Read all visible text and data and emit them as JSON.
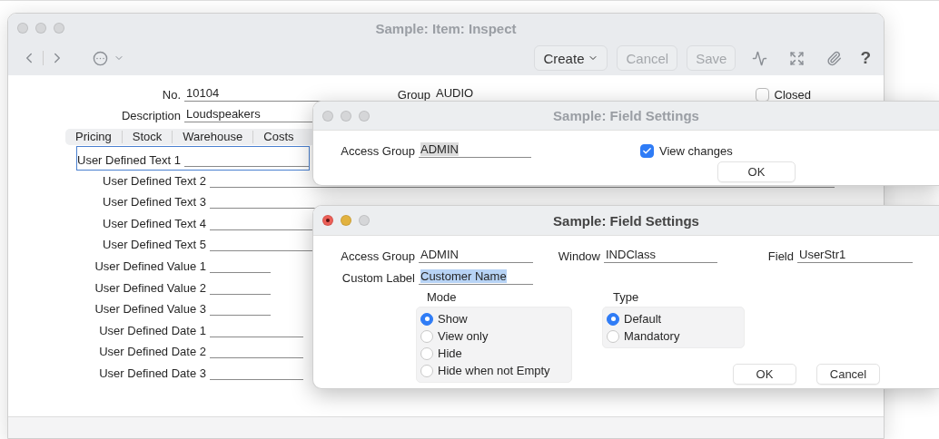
{
  "main_window": {
    "title": "Sample: Item: Inspect",
    "toolbar": {
      "buttons": [
        {
          "label": "Create",
          "kind": "menu",
          "disabled": false
        },
        {
          "label": "Cancel",
          "kind": "plain",
          "disabled": true
        },
        {
          "label": "Save",
          "kind": "plain",
          "disabled": true
        }
      ],
      "help": "?"
    },
    "header_fields": [
      {
        "label": "No.",
        "value": "10104"
      },
      {
        "label": "Description",
        "value": "Loudspeakers"
      },
      {
        "label": "Group",
        "value": "AUDIO"
      }
    ],
    "closed": {
      "label": "Closed",
      "checked": false
    },
    "tabs": [
      {
        "label": "Pricing",
        "selected": false
      },
      {
        "label": "Stock",
        "selected": false
      },
      {
        "label": "Warehouse",
        "selected": false
      },
      {
        "label": "Costs",
        "selected": false
      }
    ],
    "user_fields": [
      {
        "label": "User Defined Text 1",
        "kind": "text",
        "focused": true
      },
      {
        "label": "User Defined Text 2",
        "kind": "text",
        "focused": false
      },
      {
        "label": "User Defined Text 3",
        "kind": "text",
        "focused": false
      },
      {
        "label": "User Defined Text 4",
        "kind": "text",
        "focused": false
      },
      {
        "label": "User Defined Text 5",
        "kind": "text",
        "focused": false
      },
      {
        "label": "User Defined Value 1",
        "kind": "value",
        "focused": false
      },
      {
        "label": "User Defined Value 2",
        "kind": "value",
        "focused": false
      },
      {
        "label": "User Defined Value 3",
        "kind": "value",
        "focused": false
      },
      {
        "label": "User Defined Date 1",
        "kind": "date",
        "focused": false
      },
      {
        "label": "User Defined Date 2",
        "kind": "date",
        "focused": false
      },
      {
        "label": "User Defined Date 3",
        "kind": "date",
        "focused": false
      }
    ]
  },
  "dialogs": [
    {
      "title": "Sample: Field Settings",
      "active": false,
      "fields": [
        {
          "label": "Access Group",
          "value": "ADMIN",
          "selected": true
        }
      ],
      "view_changes": {
        "label": "View changes",
        "checked": true
      },
      "buttons": [
        "OK"
      ]
    },
    {
      "title": "Sample: Field Settings",
      "active": true,
      "fields": [
        {
          "label": "Access Group",
          "value": "ADMIN",
          "selected": false
        },
        {
          "label": "Window",
          "value": "INDClass",
          "selected": false
        },
        {
          "label": "Field",
          "value": "UserStr1",
          "selected": false
        }
      ],
      "custom_label": {
        "label": "Custom Label",
        "value": "Customer Name",
        "selected": true
      },
      "groups": [
        {
          "title": "Mode",
          "options": [
            {
              "label": "Show",
              "selected": true
            },
            {
              "label": "View only",
              "selected": false
            },
            {
              "label": "Hide",
              "selected": false
            },
            {
              "label": "Hide when not Empty",
              "selected": false
            }
          ]
        },
        {
          "title": "Type",
          "options": [
            {
              "label": "Default",
              "selected": true
            },
            {
              "label": "Mandatory",
              "selected": false
            }
          ]
        }
      ],
      "buttons": [
        "OK",
        "Cancel"
      ]
    }
  ]
}
